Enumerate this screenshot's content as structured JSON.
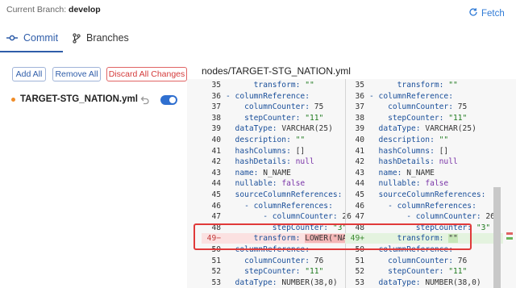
{
  "header": {
    "branch_label": "Current Branch:",
    "branch_name": "develop",
    "fetch_label": "Fetch"
  },
  "tabs": [
    {
      "label": "Commit",
      "active": true
    },
    {
      "label": "Branches",
      "active": false
    }
  ],
  "actions": {
    "add_all": "Add All",
    "remove_all": "Remove All",
    "discard_all": "Discard All Changes"
  },
  "changed_file": {
    "name": "TARGET-STG_NATION.yml",
    "status_color": "#f08c28",
    "staged": true
  },
  "diff": {
    "path": "nodes/TARGET-STG_NATION.yml",
    "left": [
      {
        "n": "35",
        "parts": [
          {
            "t": "      transform: ",
            "c": "key"
          },
          {
            "t": "\"\"",
            "c": "str"
          }
        ]
      },
      {
        "n": "36",
        "parts": [
          {
            "t": "- columnReference:",
            "c": "key"
          }
        ]
      },
      {
        "n": "37",
        "parts": [
          {
            "t": "    columnCounter: ",
            "c": "key"
          },
          {
            "t": "75",
            "c": "num"
          }
        ]
      },
      {
        "n": "38",
        "parts": [
          {
            "t": "    stepCounter: ",
            "c": "key"
          },
          {
            "t": "\"11\"",
            "c": "str"
          }
        ]
      },
      {
        "n": "39",
        "parts": [
          {
            "t": "  dataType: ",
            "c": "key"
          },
          {
            "t": "VARCHAR(25)",
            "c": "plain"
          }
        ]
      },
      {
        "n": "40",
        "parts": [
          {
            "t": "  description: ",
            "c": "key"
          },
          {
            "t": "\"\"",
            "c": "str"
          }
        ]
      },
      {
        "n": "41",
        "parts": [
          {
            "t": "  hashColumns: ",
            "c": "key"
          },
          {
            "t": "[]",
            "c": "plain"
          }
        ]
      },
      {
        "n": "42",
        "parts": [
          {
            "t": "  hashDetails: ",
            "c": "key"
          },
          {
            "t": "null",
            "c": "kw"
          }
        ]
      },
      {
        "n": "43",
        "parts": [
          {
            "t": "  name: ",
            "c": "key"
          },
          {
            "t": "N_NAME",
            "c": "plain"
          }
        ]
      },
      {
        "n": "44",
        "parts": [
          {
            "t": "  nullable: ",
            "c": "key"
          },
          {
            "t": "false",
            "c": "kw"
          }
        ]
      },
      {
        "n": "45",
        "parts": [
          {
            "t": "  sourceColumnReferences:",
            "c": "key"
          }
        ]
      },
      {
        "n": "46",
        "parts": [
          {
            "t": "    - columnReferences:",
            "c": "key"
          }
        ]
      },
      {
        "n": "47",
        "parts": [
          {
            "t": "        - columnCounter: ",
            "c": "key"
          },
          {
            "t": "26",
            "c": "num"
          }
        ]
      },
      {
        "n": "48",
        "parts": [
          {
            "t": "          stepCounter: ",
            "c": "key"
          },
          {
            "t": "\"3\"",
            "c": "str"
          }
        ]
      },
      {
        "n": "49−",
        "kind": "del",
        "parts": [
          {
            "t": "      transform: ",
            "c": "key"
          },
          {
            "t": "LOWER(\"NAT",
            "c": "hl"
          }
        ]
      },
      {
        "n": "50",
        "parts": [
          {
            "t": "- columnReference:",
            "c": "key"
          }
        ]
      },
      {
        "n": "51",
        "parts": [
          {
            "t": "    columnCounter: ",
            "c": "key"
          },
          {
            "t": "76",
            "c": "num"
          }
        ]
      },
      {
        "n": "52",
        "parts": [
          {
            "t": "    stepCounter: ",
            "c": "key"
          },
          {
            "t": "\"11\"",
            "c": "str"
          }
        ]
      },
      {
        "n": "53",
        "parts": [
          {
            "t": "  dataType: ",
            "c": "key"
          },
          {
            "t": "NUMBER(38,0)",
            "c": "plain"
          }
        ]
      }
    ],
    "right": [
      {
        "n": "35",
        "parts": [
          {
            "t": "      transform: ",
            "c": "key"
          },
          {
            "t": "\"\"",
            "c": "str"
          }
        ]
      },
      {
        "n": "36",
        "parts": [
          {
            "t": "- columnReference:",
            "c": "key"
          }
        ]
      },
      {
        "n": "37",
        "parts": [
          {
            "t": "    columnCounter: ",
            "c": "key"
          },
          {
            "t": "75",
            "c": "num"
          }
        ]
      },
      {
        "n": "38",
        "parts": [
          {
            "t": "    stepCounter: ",
            "c": "key"
          },
          {
            "t": "\"11\"",
            "c": "str"
          }
        ]
      },
      {
        "n": "39",
        "parts": [
          {
            "t": "  dataType: ",
            "c": "key"
          },
          {
            "t": "VARCHAR(25)",
            "c": "plain"
          }
        ]
      },
      {
        "n": "40",
        "parts": [
          {
            "t": "  description: ",
            "c": "key"
          },
          {
            "t": "\"\"",
            "c": "str"
          }
        ]
      },
      {
        "n": "41",
        "parts": [
          {
            "t": "  hashColumns: ",
            "c": "key"
          },
          {
            "t": "[]",
            "c": "plain"
          }
        ]
      },
      {
        "n": "42",
        "parts": [
          {
            "t": "  hashDetails: ",
            "c": "key"
          },
          {
            "t": "null",
            "c": "kw"
          }
        ]
      },
      {
        "n": "43",
        "parts": [
          {
            "t": "  name: ",
            "c": "key"
          },
          {
            "t": "N_NAME",
            "c": "plain"
          }
        ]
      },
      {
        "n": "44",
        "parts": [
          {
            "t": "  nullable: ",
            "c": "key"
          },
          {
            "t": "false",
            "c": "kw"
          }
        ]
      },
      {
        "n": "45",
        "parts": [
          {
            "t": "  sourceColumnReferences:",
            "c": "key"
          }
        ]
      },
      {
        "n": "46",
        "parts": [
          {
            "t": "    - columnReferences:",
            "c": "key"
          }
        ]
      },
      {
        "n": "47",
        "parts": [
          {
            "t": "        - columnCounter: ",
            "c": "key"
          },
          {
            "t": "26",
            "c": "num"
          }
        ]
      },
      {
        "n": "48",
        "parts": [
          {
            "t": "          stepCounter: ",
            "c": "key"
          },
          {
            "t": "\"3\"",
            "c": "str"
          }
        ]
      },
      {
        "n": "49+",
        "kind": "add",
        "parts": [
          {
            "t": "      transform: ",
            "c": "key"
          },
          {
            "t": "\"\"",
            "c": "hla"
          }
        ]
      },
      {
        "n": "50",
        "parts": [
          {
            "t": "- columnReference:",
            "c": "key"
          }
        ]
      },
      {
        "n": "51",
        "parts": [
          {
            "t": "    columnCounter: ",
            "c": "key"
          },
          {
            "t": "76",
            "c": "num"
          }
        ]
      },
      {
        "n": "52",
        "parts": [
          {
            "t": "    stepCounter: ",
            "c": "key"
          },
          {
            "t": "\"11\"",
            "c": "str"
          }
        ]
      },
      {
        "n": "53",
        "parts": [
          {
            "t": "  dataType: ",
            "c": "key"
          },
          {
            "t": "NUMBER(38,0)",
            "c": "plain"
          }
        ]
      }
    ]
  },
  "colors": {
    "accent": "#2f5da9",
    "link": "#2f7ad6",
    "danger": "#d43b3b",
    "deleted_bg": "#fbe1e1",
    "added_bg": "#e4f3df"
  }
}
